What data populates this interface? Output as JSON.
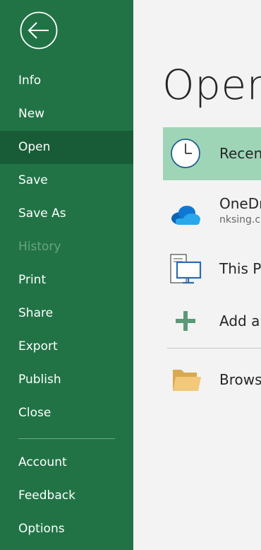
{
  "sidebar": {
    "items": [
      {
        "label": "Info"
      },
      {
        "label": "New"
      },
      {
        "label": "Open"
      },
      {
        "label": "Save"
      },
      {
        "label": "Save As"
      },
      {
        "label": "History"
      },
      {
        "label": "Print"
      },
      {
        "label": "Share"
      },
      {
        "label": "Export"
      },
      {
        "label": "Publish"
      },
      {
        "label": "Close"
      }
    ],
    "bottom_items": [
      {
        "label": "Account"
      },
      {
        "label": "Feedback"
      },
      {
        "label": "Options"
      }
    ],
    "active_item": "Open",
    "disabled_item": "History"
  },
  "main": {
    "title": "Open",
    "locations": [
      {
        "label": "Recent",
        "icon": "clock-icon",
        "selected": true
      },
      {
        "label": "OneDrive",
        "sub": "nksing.c",
        "icon": "onedrive-cloud-icon"
      },
      {
        "label": "This PC",
        "icon": "computer-icon"
      },
      {
        "label": "Add a Place",
        "icon": "plus-icon"
      },
      {
        "label": "Browse",
        "icon": "folder-icon"
      }
    ]
  },
  "colors": {
    "sidebar_bg": "#217346",
    "sidebar_active": "#185c37",
    "selected_location": "#9fd5b7",
    "main_bg": "#f3f3f3"
  }
}
